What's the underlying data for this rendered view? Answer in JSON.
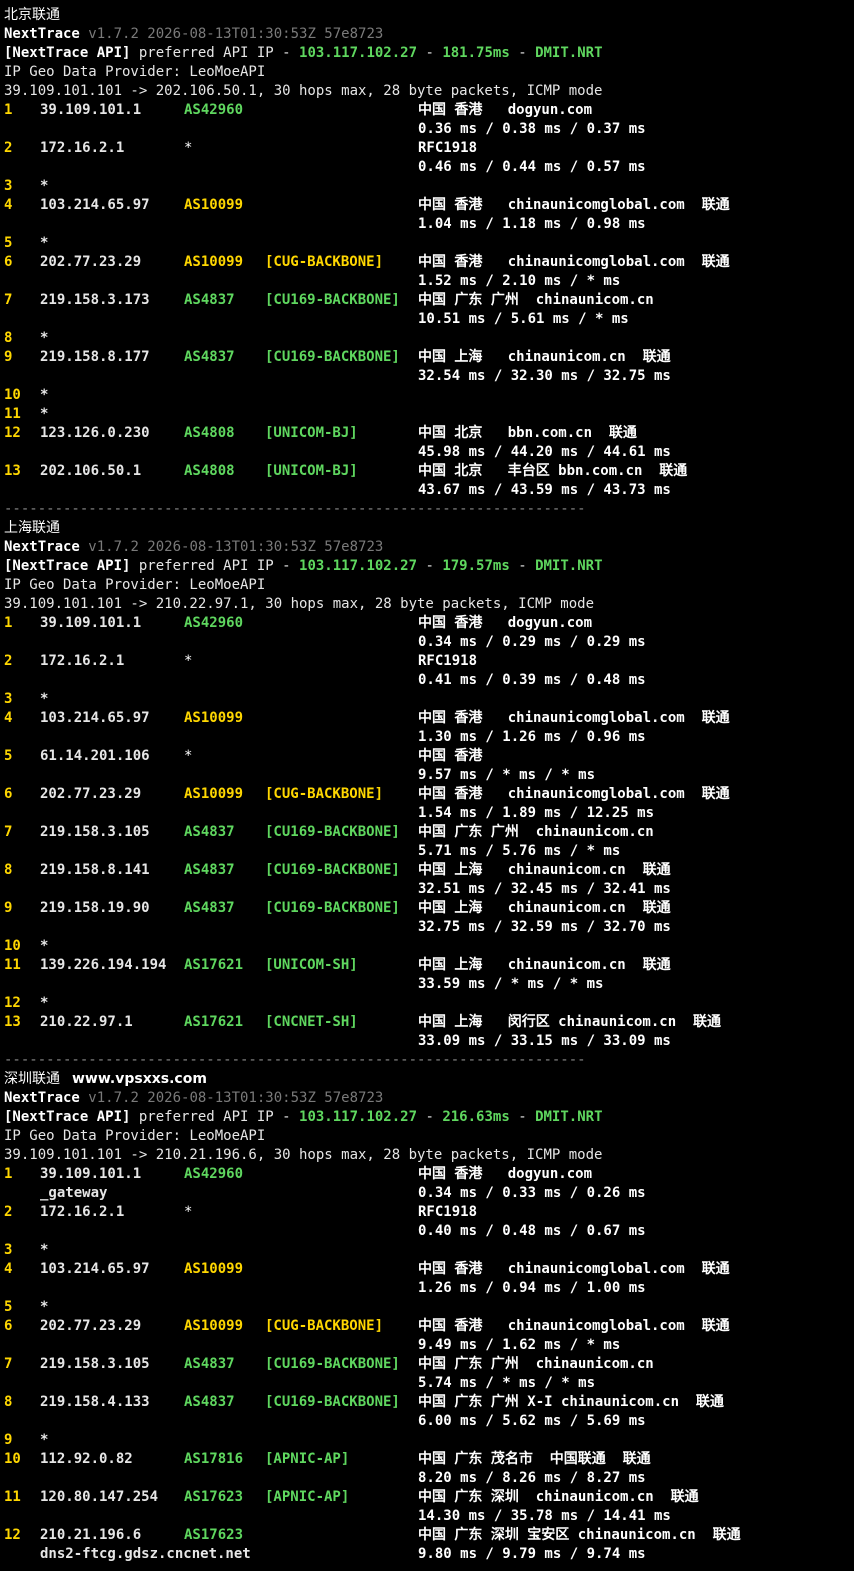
{
  "sections": [
    {
      "title": "北京联通",
      "watermark": "",
      "app": "NextTrace",
      "version": "v1.7.2 2026-08-13T01:30:53Z 57e8723",
      "api_prefix": "[NextTrace API]",
      "api_text": " preferred API IP - ",
      "api_ip": "103.117.102.27",
      "api_dash": " - ",
      "api_ms": "181.75ms",
      "api_dash2": " - ",
      "api_node": "DMIT.NRT",
      "geo_provider": "IP Geo Data Provider: LeoMoeAPI",
      "trace_cmd": "39.109.101.101 -> 202.106.50.1, 30 hops max, 28 byte packets, ICMP mode",
      "hops": [
        {
          "num": "1",
          "ip": "39.109.101.1",
          "as": "AS42960",
          "tag": "",
          "geo": "中国 香港   dogyun.com",
          "rtt": "0.36 ms / 0.38 ms / 0.37 ms"
        },
        {
          "num": "2",
          "ip": "172.16.2.1",
          "as": "*",
          "tag": "",
          "geo": "RFC1918",
          "rtt": "0.46 ms / 0.44 ms / 0.57 ms"
        },
        {
          "num": "3",
          "ip": "*"
        },
        {
          "num": "4",
          "ip": "103.214.65.97",
          "as": "AS10099",
          "tag": "",
          "geo": "中国 香港   chinaunicomglobal.com  联通",
          "rtt": "1.04 ms / 1.18 ms / 0.98 ms"
        },
        {
          "num": "5",
          "ip": "*"
        },
        {
          "num": "6",
          "ip": "202.77.23.29",
          "as": "AS10099",
          "tag": "[CUG-BACKBONE]",
          "geo": "中国 香港   chinaunicomglobal.com  联通",
          "rtt": "1.52 ms / 2.10 ms / * ms"
        },
        {
          "num": "7",
          "ip": "219.158.3.173",
          "as": "AS4837",
          "tag": "[CU169-BACKBONE]",
          "geo": "中国 广东 广州  chinaunicom.cn",
          "rtt": "10.51 ms / 5.61 ms / * ms"
        },
        {
          "num": "8",
          "ip": "*"
        },
        {
          "num": "9",
          "ip": "219.158.8.177",
          "as": "AS4837",
          "tag": "[CU169-BACKBONE]",
          "geo": "中国 上海   chinaunicom.cn  联通",
          "rtt": "32.54 ms / 32.30 ms / 32.75 ms"
        },
        {
          "num": "10",
          "ip": "*"
        },
        {
          "num": "11",
          "ip": "*"
        },
        {
          "num": "12",
          "ip": "123.126.0.230",
          "as": "AS4808",
          "tag": "[UNICOM-BJ]",
          "geo": "中国 北京   bbn.com.cn  联通",
          "rtt": "45.98 ms / 44.20 ms / 44.61 ms"
        },
        {
          "num": "13",
          "ip": "202.106.50.1",
          "as": "AS4808",
          "tag": "[UNICOM-BJ]",
          "geo": "中国 北京   丰台区 bbn.com.cn  联通",
          "rtt": "43.67 ms / 43.59 ms / 43.73 ms"
        }
      ]
    },
    {
      "title": "上海联通",
      "watermark": "",
      "app": "NextTrace",
      "version": "v1.7.2 2026-08-13T01:30:53Z 57e8723",
      "api_prefix": "[NextTrace API]",
      "api_text": " preferred API IP - ",
      "api_ip": "103.117.102.27",
      "api_dash": " - ",
      "api_ms": "179.57ms",
      "api_dash2": " - ",
      "api_node": "DMIT.NRT",
      "geo_provider": "IP Geo Data Provider: LeoMoeAPI",
      "trace_cmd": "39.109.101.101 -> 210.22.97.1, 30 hops max, 28 byte packets, ICMP mode",
      "hops": [
        {
          "num": "1",
          "ip": "39.109.101.1",
          "as": "AS42960",
          "tag": "",
          "geo": "中国 香港   dogyun.com",
          "rtt": "0.34 ms / 0.29 ms / 0.29 ms"
        },
        {
          "num": "2",
          "ip": "172.16.2.1",
          "as": "*",
          "tag": "",
          "geo": "RFC1918",
          "rtt": "0.41 ms / 0.39 ms / 0.48 ms"
        },
        {
          "num": "3",
          "ip": "*"
        },
        {
          "num": "4",
          "ip": "103.214.65.97",
          "as": "AS10099",
          "tag": "",
          "geo": "中国 香港   chinaunicomglobal.com  联通",
          "rtt": "1.30 ms / 1.26 ms / 0.96 ms"
        },
        {
          "num": "5",
          "ip": "61.14.201.106",
          "as": "*",
          "tag": "",
          "geo": "中国 香港",
          "rtt": "9.57 ms / * ms / * ms"
        },
        {
          "num": "6",
          "ip": "202.77.23.29",
          "as": "AS10099",
          "tag": "[CUG-BACKBONE]",
          "geo": "中国 香港   chinaunicomglobal.com  联通",
          "rtt": "1.54 ms / 1.89 ms / 12.25 ms"
        },
        {
          "num": "7",
          "ip": "219.158.3.105",
          "as": "AS4837",
          "tag": "[CU169-BACKBONE]",
          "geo": "中国 广东 广州  chinaunicom.cn",
          "rtt": "5.71 ms / 5.76 ms / * ms"
        },
        {
          "num": "8",
          "ip": "219.158.8.141",
          "as": "AS4837",
          "tag": "[CU169-BACKBONE]",
          "geo": "中国 上海   chinaunicom.cn  联通",
          "rtt": "32.51 ms / 32.45 ms / 32.41 ms"
        },
        {
          "num": "9",
          "ip": "219.158.19.90",
          "as": "AS4837",
          "tag": "[CU169-BACKBONE]",
          "geo": "中国 上海   chinaunicom.cn  联通",
          "rtt": "32.75 ms / 32.59 ms / 32.70 ms"
        },
        {
          "num": "10",
          "ip": "*"
        },
        {
          "num": "11",
          "ip": "139.226.194.194",
          "as": "AS17621",
          "tag": "[UNICOM-SH]",
          "geo": "中国 上海   chinaunicom.cn  联通",
          "rtt": "33.59 ms / * ms / * ms"
        },
        {
          "num": "12",
          "ip": "*"
        },
        {
          "num": "13",
          "ip": "210.22.97.1",
          "as": "AS17621",
          "tag": "[CNCNET-SH]",
          "geo": "中国 上海   闵行区 chinaunicom.cn  联通",
          "rtt": "33.09 ms / 33.15 ms / 33.09 ms"
        }
      ]
    },
    {
      "title": "深圳联通",
      "watermark": "www.vpsxxs.com",
      "app": "NextTrace",
      "version": "v1.7.2 2026-08-13T01:30:53Z 57e8723",
      "api_prefix": "[NextTrace API]",
      "api_text": " preferred API IP - ",
      "api_ip": "103.117.102.27",
      "api_dash": " - ",
      "api_ms": "216.63ms",
      "api_dash2": " - ",
      "api_node": "DMIT.NRT",
      "geo_provider": "IP Geo Data Provider: LeoMoeAPI",
      "trace_cmd": "39.109.101.101 -> 210.21.196.6, 30 hops max, 28 byte packets, ICMP mode",
      "hops": [
        {
          "num": "1",
          "ip": "39.109.101.1",
          "sub": "_gateway",
          "as": "AS42960",
          "tag": "",
          "geo": "中国 香港   dogyun.com",
          "rtt": "0.34 ms / 0.33 ms / 0.26 ms"
        },
        {
          "num": "2",
          "ip": "172.16.2.1",
          "as": "*",
          "tag": "",
          "geo": "RFC1918",
          "rtt": "0.40 ms / 0.48 ms / 0.67 ms"
        },
        {
          "num": "3",
          "ip": "*"
        },
        {
          "num": "4",
          "ip": "103.214.65.97",
          "as": "AS10099",
          "tag": "",
          "geo": "中国 香港   chinaunicomglobal.com  联通",
          "rtt": "1.26 ms / 0.94 ms / 1.00 ms"
        },
        {
          "num": "5",
          "ip": "*"
        },
        {
          "num": "6",
          "ip": "202.77.23.29",
          "as": "AS10099",
          "tag": "[CUG-BACKBONE]",
          "geo": "中国 香港   chinaunicomglobal.com  联通",
          "rtt": "9.49 ms / 1.62 ms / * ms"
        },
        {
          "num": "7",
          "ip": "219.158.3.105",
          "as": "AS4837",
          "tag": "[CU169-BACKBONE]",
          "geo": "中国 广东 广州  chinaunicom.cn",
          "rtt": "5.74 ms / * ms / * ms"
        },
        {
          "num": "8",
          "ip": "219.158.4.133",
          "as": "AS4837",
          "tag": "[CU169-BACKBONE]",
          "geo": "中国 广东 广州 X-I chinaunicom.cn  联通",
          "rtt": "6.00 ms / 5.62 ms / 5.69 ms"
        },
        {
          "num": "9",
          "ip": "*"
        },
        {
          "num": "10",
          "ip": "112.92.0.82",
          "as": "AS17816",
          "tag": "[APNIC-AP]",
          "geo": "中国 广东 茂名市  中国联通  联通",
          "rtt": "8.20 ms / 8.26 ms / 8.27 ms"
        },
        {
          "num": "11",
          "ip": "120.80.147.254",
          "as": "AS17623",
          "tag": "[APNIC-AP]",
          "geo": "中国 广东 深圳  chinaunicom.cn  联通",
          "rtt": "14.30 ms / 35.78 ms / 14.41 ms"
        },
        {
          "num": "12",
          "ip": "210.21.196.6",
          "sub": "dns2-ftcg.gdsz.cncnet.net",
          "as": "AS17623",
          "tag": "",
          "geo": "中国 广东 深圳 宝安区 chinaunicom.cn  联通",
          "rtt": "9.80 ms / 9.79 ms / 9.74 ms"
        }
      ]
    }
  ],
  "separator": "---------------------------------------------------------------------",
  "colors": {
    "background": "#000000",
    "green": "#5fd75f",
    "yellow": "#ffd700",
    "cyan": "#5fd7ff"
  }
}
